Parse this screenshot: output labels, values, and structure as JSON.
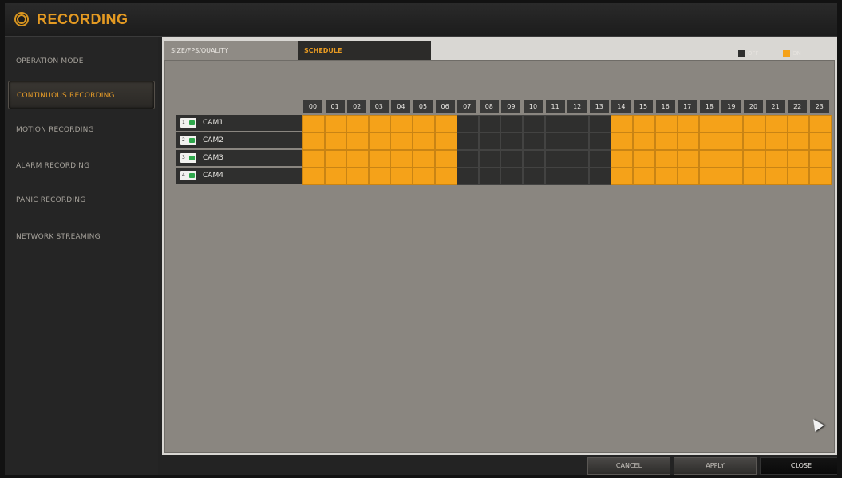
{
  "window": {
    "title": "RECORDING"
  },
  "sidebar": {
    "items": [
      {
        "label": "OPERATION MODE",
        "active": false
      },
      {
        "label": "CONTINUOUS RECORDING",
        "active": true
      },
      {
        "label": "MOTION RECORDING",
        "active": false
      },
      {
        "label": "ALARM RECORDING",
        "active": false
      },
      {
        "label": "PANIC RECORDING",
        "active": false
      },
      {
        "label": "NETWORK STREAMING",
        "active": false
      }
    ]
  },
  "tabs": [
    {
      "label": "SIZE/FPS/QUALITY",
      "active": false
    },
    {
      "label": "SCHEDULE",
      "active": true
    }
  ],
  "legend": {
    "off_label": "OFF",
    "on_label": "ON",
    "off_color": "#2f2f2e",
    "on_color": "#f5a219"
  },
  "schedule": {
    "hours": [
      "00",
      "01",
      "02",
      "03",
      "04",
      "05",
      "06",
      "07",
      "08",
      "09",
      "10",
      "11",
      "12",
      "13",
      "14",
      "15",
      "16",
      "17",
      "18",
      "19",
      "20",
      "21",
      "22",
      "23"
    ],
    "cameras": [
      {
        "name": "CAM1",
        "number": "1",
        "slots": [
          1,
          1,
          1,
          1,
          1,
          1,
          1,
          0,
          0,
          0,
          0,
          0,
          0,
          0,
          1,
          1,
          1,
          1,
          1,
          1,
          1,
          1,
          1,
          1
        ]
      },
      {
        "name": "CAM2",
        "number": "2",
        "slots": [
          1,
          1,
          1,
          1,
          1,
          1,
          1,
          0,
          0,
          0,
          0,
          0,
          0,
          0,
          1,
          1,
          1,
          1,
          1,
          1,
          1,
          1,
          1,
          1
        ]
      },
      {
        "name": "CAM3",
        "number": "3",
        "slots": [
          1,
          1,
          1,
          1,
          1,
          1,
          1,
          0,
          0,
          0,
          0,
          0,
          0,
          0,
          1,
          1,
          1,
          1,
          1,
          1,
          1,
          1,
          1,
          1
        ]
      },
      {
        "name": "CAM4",
        "number": "4",
        "slots": [
          1,
          1,
          1,
          1,
          1,
          1,
          1,
          0,
          0,
          0,
          0,
          0,
          0,
          0,
          1,
          1,
          1,
          1,
          1,
          1,
          1,
          1,
          1,
          1
        ]
      }
    ]
  },
  "buttons": {
    "cancel": "CANCEL",
    "apply": "APPLY",
    "close": "CLOSE"
  },
  "icons": {
    "title": "film-reel-icon",
    "camera": "camera-icon",
    "cursor": "mouse-pointer-icon"
  }
}
